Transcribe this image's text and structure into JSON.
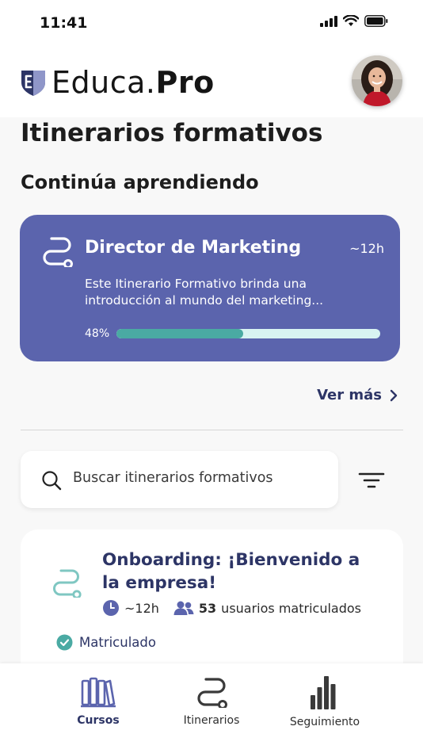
{
  "status_bar": {
    "time": "11:41"
  },
  "header": {
    "logo_word": "Educa",
    "logo_dot": ".",
    "logo_suffix": "Pro"
  },
  "page_title": "Itinerarios formativos",
  "continue_section": {
    "title": "Continúa aprendiendo",
    "card": {
      "title": "Director de Marketing",
      "duration": "~12h",
      "description": "Este Itinerario Formativo brinda una introducción al mundo del marketing...",
      "progress_label": "48%",
      "progress_value": 0.48
    },
    "see_more": "Ver más"
  },
  "search": {
    "placeholder": "Buscar itinerarios formativos"
  },
  "course": {
    "title": "Onboarding: ¡Bienvenido a la empresa!",
    "duration": "~12h",
    "users_count": "53",
    "users_label": "usuarios matriculados",
    "status": "Matriculado"
  },
  "tabs": [
    {
      "label": "Cursos",
      "icon": "books-icon",
      "active": true
    },
    {
      "label": "Itinerarios",
      "icon": "route-icon",
      "active": false
    },
    {
      "label": "Seguimiento",
      "icon": "bar-chart-icon",
      "active": false
    }
  ],
  "colors": {
    "accent": "#5b64ad",
    "navy": "#2d3566",
    "teal": "#4aaaa3",
    "progress_track": "#d8f3f2"
  }
}
